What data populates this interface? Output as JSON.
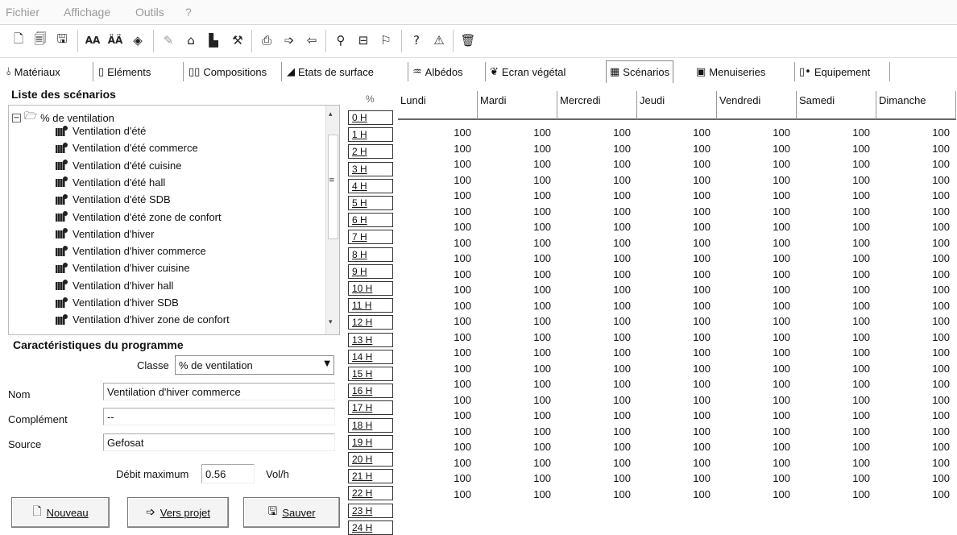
{
  "menu": {
    "items": [
      "Fichier",
      "Affichage",
      "Outils",
      "?"
    ]
  },
  "toolbar": {
    "icons": [
      "new-doc-icon",
      "copy-doc-icon",
      "save-doc-icon",
      "text-a-icon",
      "text-a2-icon",
      "tag-icon",
      "pencil-icon",
      "building-icon",
      "chart-icon",
      "tool-icon",
      "print-icon",
      "export-icon",
      "import-icon",
      "search-icon",
      "find-replace-icon",
      "wizard-icon",
      "help-icon",
      "warning-icon",
      "delete-icon"
    ]
  },
  "tabs": [
    {
      "label": "Matériaux",
      "icon": "thermo-icon"
    },
    {
      "label": "Eléments",
      "icon": "element-icon"
    },
    {
      "label": "Compositions",
      "icon": "composition-icon"
    },
    {
      "label": "Etats de surface",
      "icon": "surface-icon"
    },
    {
      "label": "Albédos",
      "icon": "albedo-icon"
    },
    {
      "label": "Ecran végétal",
      "icon": "plant-icon"
    },
    {
      "label": "Scénarios",
      "icon": "grid-icon"
    },
    {
      "label": "Menuiseries",
      "icon": "window-icon"
    },
    {
      "label": "Equipement",
      "icon": "equipment-icon"
    }
  ],
  "scenarios": {
    "title": "Liste des scénarios",
    "root": "% de ventilation",
    "items": [
      "Ventilation d'été",
      "Ventilation d'été commerce",
      "Ventilation d'été cuisine",
      "Ventilation d'été hall",
      "Ventilation d'été SDB",
      "Ventilation d'été zone de confort",
      "Ventilation d'hiver",
      "Ventilation d'hiver commerce",
      "Ventilation d'hiver cuisine",
      "Ventilation d'hiver hall",
      "Ventilation d'hiver SDB",
      "Ventilation d'hiver zone de confort"
    ]
  },
  "programme": {
    "title": "Caractéristiques du programme",
    "classe_label": "Classe",
    "classe_value": "% de ventilation",
    "nom_label": "Nom",
    "nom_value": "Ventilation d'hiver commerce",
    "complement_label": "Complément",
    "complement_value": "--",
    "source_label": "Source",
    "source_value": "Gefosat",
    "debit_label": "Débit maximum",
    "debit_value": "0.56",
    "debit_unit": "Vol/h"
  },
  "buttons": {
    "nouveau": "Nouveau",
    "vers_projet": "Vers projet",
    "sauver": "Sauver"
  },
  "hours": {
    "pct_label": "%",
    "labels": [
      "0 H",
      "1 H",
      "2 H",
      "3 H",
      "4 H",
      "5 H",
      "6 H",
      "7 H",
      "8 H",
      "9 H",
      "10 H",
      "11 H",
      "12 H",
      "13 H",
      "14 H",
      "15 H",
      "16 H",
      "17 H",
      "18 H",
      "19 H",
      "20 H",
      "21 H",
      "22 H",
      "23 H",
      "24 H"
    ]
  },
  "grid": {
    "days": [
      "Lundi",
      "Mardi",
      "Mercredi",
      "Jeudi",
      "Vendredi",
      "Samedi",
      "Dimanche"
    ],
    "value": "100",
    "rows": 24
  }
}
